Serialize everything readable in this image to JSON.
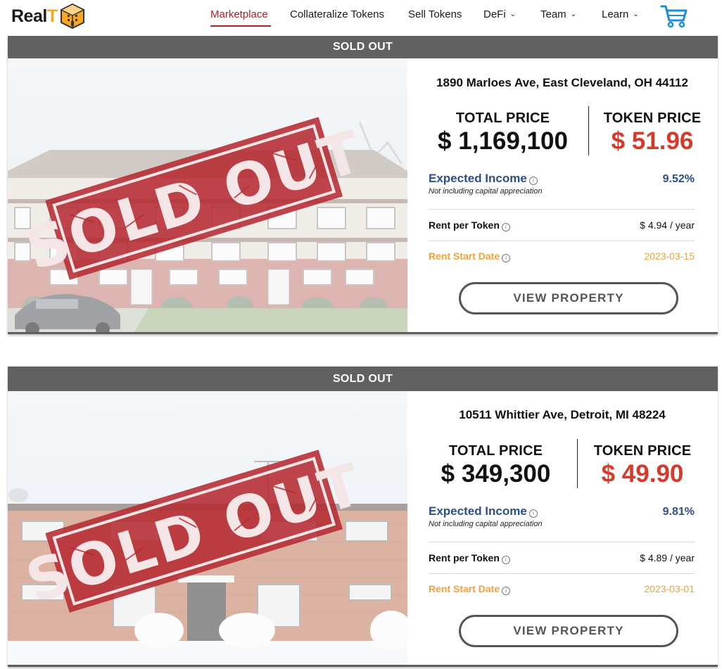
{
  "brand": {
    "name_prefix": "Real",
    "name_suffix": "T"
  },
  "nav": {
    "items": [
      {
        "label": "Marketplace",
        "active": true,
        "dropdown": false
      },
      {
        "label": "Collateralize Tokens",
        "active": false,
        "dropdown": false
      },
      {
        "label": "Sell Tokens",
        "active": false,
        "dropdown": false
      },
      {
        "label": "DeFi",
        "active": false,
        "dropdown": true
      },
      {
        "label": "Team",
        "active": false,
        "dropdown": true
      },
      {
        "label": "Learn",
        "active": false,
        "dropdown": true
      }
    ],
    "cart_icon": "shopping-cart-icon",
    "dropdown_icon": "chevron-down-icon"
  },
  "labels": {
    "total_price": "TOTAL PRICE",
    "token_price": "TOKEN PRICE",
    "expected_income": "Expected Income",
    "expected_income_note": "Not including capital appreciation",
    "rent_per_token": "Rent per Token",
    "rent_start_date": "Rent Start Date",
    "view_property": "VIEW PROPERTY",
    "info_icon": "i"
  },
  "stamp_text": "SOLD OUT",
  "properties": [
    {
      "status": "SOLD OUT",
      "address": "1890 Marloes Ave, East Cleveland, OH 44112",
      "total_price": "$ 1,169,100",
      "token_price": "$ 51.96",
      "expected_income": "9.52%",
      "rent_per_token": "$ 4.94 / year",
      "rent_start_date": "2023-03-15"
    },
    {
      "status": "SOLD OUT",
      "address": "10511 Whittier Ave, Detroit, MI 48224",
      "total_price": "$ 349,300",
      "token_price": "$ 49.90",
      "expected_income": "9.81%",
      "rent_per_token": "$ 4.89 / year",
      "rent_start_date": "2023-03-01"
    }
  ],
  "colors": {
    "accent_red": "#a9232f",
    "price_red": "#d7392b",
    "income_blue": "#2b4f8c",
    "rent_orange": "#f2a23a",
    "status_bar": "#616161",
    "logo_orange": "#f5a623",
    "cart_blue": "#1a8fd8"
  }
}
